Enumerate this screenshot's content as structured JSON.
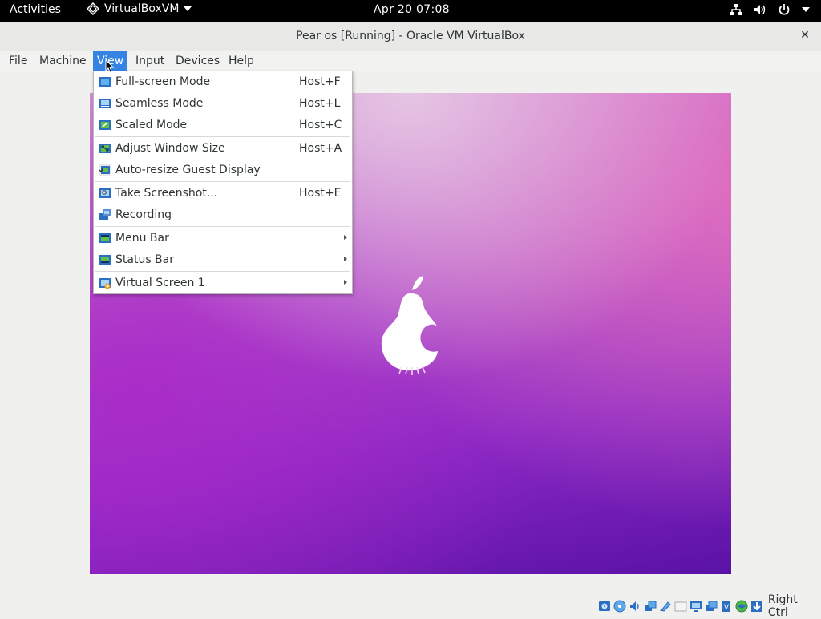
{
  "topbar": {
    "activities": "Activities",
    "app_name": "VirtualBoxVM",
    "clock": "Apr 20  07:08"
  },
  "window": {
    "title": "Pear os [Running] - Oracle VM VirtualBox",
    "close_glyph": "✕"
  },
  "menubar": {
    "items": [
      "File",
      "Machine",
      "View",
      "Input",
      "Devices",
      "Help"
    ],
    "active": "View"
  },
  "view_menu": {
    "items": [
      {
        "label": "Full-screen Mode",
        "shortcut": "Host+F",
        "icon": "fullscreen-icon"
      },
      {
        "label": "Seamless Mode",
        "shortcut": "Host+L",
        "icon": "seamless-icon"
      },
      {
        "label": "Scaled Mode",
        "shortcut": "Host+C",
        "icon": "scaled-icon"
      },
      {
        "label": "Adjust Window Size",
        "shortcut": "Host+A",
        "icon": "adjust-window-icon"
      },
      {
        "label": "Auto-resize Guest Display",
        "shortcut": "",
        "icon": "auto-resize-icon"
      },
      {
        "label": "Take Screenshot...",
        "shortcut": "Host+E",
        "icon": "screenshot-icon"
      },
      {
        "label": "Recording",
        "shortcut": "",
        "icon": "recording-icon"
      },
      {
        "label": "Menu Bar",
        "shortcut": "",
        "icon": "menu-bar-icon",
        "submenu": true
      },
      {
        "label": "Status Bar",
        "shortcut": "",
        "icon": "status-bar-icon",
        "submenu": true
      },
      {
        "label": "Virtual Screen 1",
        "shortcut": "",
        "icon": "virtual-screen-icon",
        "submenu": true
      }
    ]
  },
  "statusbar": {
    "host_key": "Right Ctrl",
    "icons": [
      "hard-disk-icon",
      "optical-drive-icon",
      "audio-icon",
      "network-icon",
      "usb-icon",
      "shared-folder-icon",
      "display-icon",
      "recording-status-icon",
      "cpu-icon",
      "mouse-integration-icon",
      "keyboard-capture-icon"
    ]
  },
  "colors": {
    "accent": "#3584e4",
    "topbar": "#000000",
    "menu_bg": "#ffffff"
  }
}
